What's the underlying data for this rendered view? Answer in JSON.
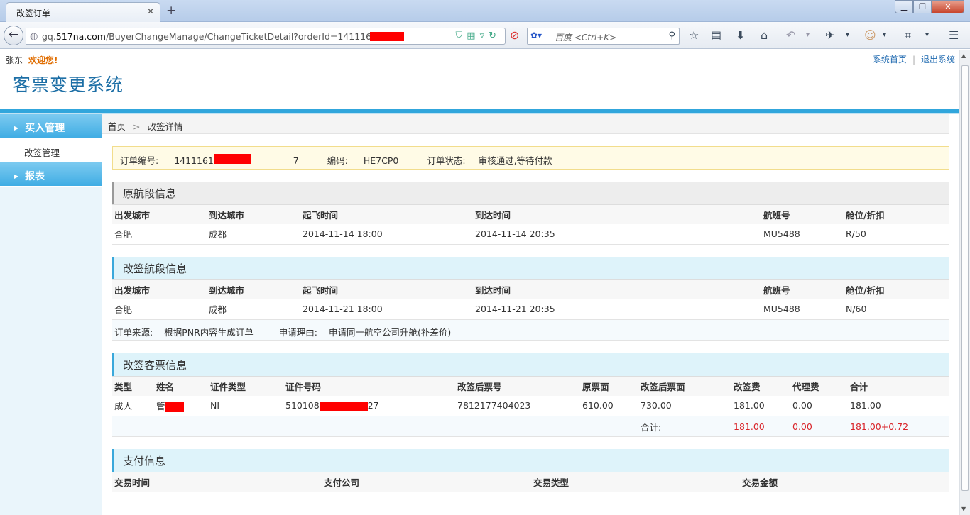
{
  "browser": {
    "tab_title": "改签订单",
    "url_prefix": "gq.",
    "url_host": "517na.com",
    "url_path": "/BuyerChangeManage/ChangeTicketDetail?orderId=14111618193",
    "search_engine": "百度",
    "search_placeholder": "百度 <Ctrl+K>"
  },
  "header": {
    "user": "张东",
    "welcome": "欢迎您!",
    "link_home": "系统首页",
    "link_logout": "退出系统",
    "logo": "客票变更系统"
  },
  "sidebar": {
    "items": [
      {
        "label": "买入管理",
        "type": "head"
      },
      {
        "label": "改签管理",
        "type": "sub"
      },
      {
        "label": "报表",
        "type": "head"
      }
    ]
  },
  "breadcrumb": {
    "home": "首页",
    "current": "改签详情"
  },
  "order": {
    "number_label": "订单编号:",
    "number_value": "1411161819",
    "number_tail": "7",
    "code_label": "编码:",
    "code_value": "HE7CP0",
    "status_label": "订单状态:",
    "status_value": "审核通过,等待付款"
  },
  "original_segment": {
    "title": "原航段信息",
    "headers": [
      "出发城市",
      "到达城市",
      "起飞时间",
      "到达时间",
      "航班号",
      "舱位/折扣"
    ],
    "row": [
      "合肥",
      "成都",
      "2014-11-14 18:00",
      "2014-11-14 20:35",
      "MU5488",
      "R/50"
    ]
  },
  "changed_segment": {
    "title": "改签航段信息",
    "headers": [
      "出发城市",
      "到达城市",
      "起飞时间",
      "到达时间",
      "航班号",
      "舱位/折扣"
    ],
    "row": [
      "合肥",
      "成都",
      "2014-11-21 18:00",
      "2014-11-21 20:35",
      "MU5488",
      "N/60"
    ],
    "source_label": "订单来源:",
    "source_value": "根据PNR内容生成订单",
    "reason_label": "申请理由:",
    "reason_value": "申请同一航空公司升舱(补差价)"
  },
  "passenger": {
    "title": "改签客票信息",
    "headers": [
      "类型",
      "姓名",
      "证件类型",
      "证件号码",
      "改签后票号",
      "原票面",
      "改签后票面",
      "改签费",
      "代理费",
      "合计"
    ],
    "row": {
      "type": "成人",
      "name": "管",
      "id_type": "NI",
      "id_prefix": "510108",
      "id_suffix": "27",
      "new_ticket": "7812177404023",
      "orig_fare": "610.00",
      "new_fare": "730.00",
      "change_fee": "181.00",
      "agent_fee": "0.00",
      "total": "181.00"
    },
    "sum_label": "合计:",
    "sum_change_fee": "181.00",
    "sum_agent_fee": "0.00",
    "sum_total": "181.00+0.72"
  },
  "payment": {
    "title": "支付信息",
    "headers": [
      "交易时间",
      "支付公司",
      "交易类型",
      "交易金额"
    ]
  }
}
